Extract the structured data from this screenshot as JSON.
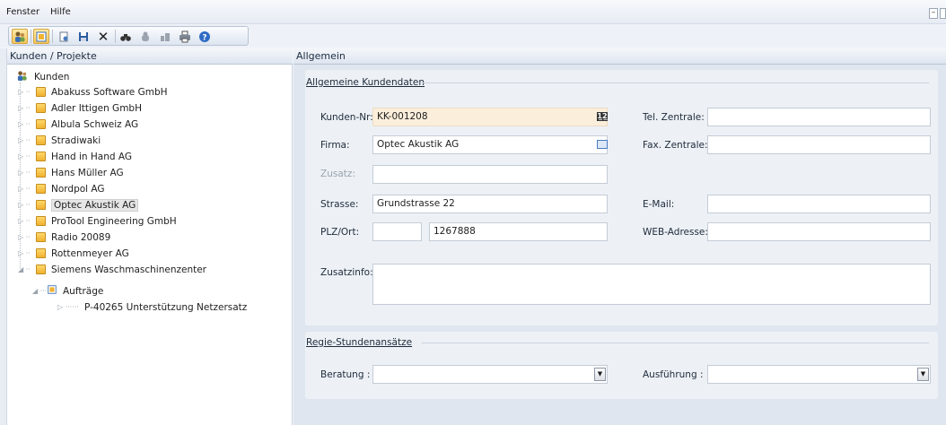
{
  "menu": {
    "fenster": "Fenster",
    "hilfe": "Hilfe"
  },
  "left_panel": {
    "title": "Kunden / Projekte"
  },
  "tree": {
    "root": "Kunden",
    "customers": [
      "Abakuss Software GmbH",
      "Adler Ittigen GmbH",
      "Albula Schweiz AG",
      "Stradiwaki",
      "Hand in Hand AG",
      "Hans Müller AG",
      "Nordpol AG",
      "Optec Akustik AG",
      "ProTool Engineering GmbH",
      "Radio 20089",
      "Rottenmeyer AG",
      "Siemens Waschmaschinenzenter"
    ],
    "selected": "Optec Akustik AG",
    "orders_label": "Aufträge",
    "project": "P-40265 Unterstützung Netzersatz"
  },
  "right_panel": {
    "title": "Allgemein"
  },
  "form": {
    "section_general": "Allgemeine Kundendaten",
    "labels": {
      "kunden_nr": "Kunden-Nr:",
      "firma": "Firma:",
      "zusatz": "Zusatz:",
      "strasse": "Strasse:",
      "plz_ort": "PLZ/Ort:",
      "zusatzinfo": "Zusatzinfo:",
      "tel_zentrale": "Tel. Zentrale:",
      "fax_zentrale": "Fax. Zentrale:",
      "email": "E-Mail:",
      "web": "WEB-Adresse:"
    },
    "values": {
      "kunden_nr": "KK-001208",
      "firma": "Optec Akustik AG",
      "zusatz": "",
      "strasse": "Grundstrasse 22",
      "plz": "",
      "ort": "1267888",
      "zusatzinfo": "",
      "tel_zentrale": "",
      "fax_zentrale": "",
      "email": "",
      "web": ""
    },
    "section_rates": "Regie-Stundenansätze",
    "rate_labels": {
      "beratung": "Beratung :",
      "ausfuehrung": "Ausführung :"
    },
    "rate_values": {
      "beratung": "",
      "ausfuehrung": ""
    }
  },
  "icons": {
    "toolbar": [
      "customers-icon",
      "projects-icon",
      "new-icon",
      "save-icon",
      "delete-icon",
      "binoculars-icon",
      "disabled-icon-1",
      "disabled-icon-2",
      "print-icon",
      "help-icon"
    ],
    "accent_orange": "#f5c65b",
    "folder_color": "#f0b230"
  }
}
